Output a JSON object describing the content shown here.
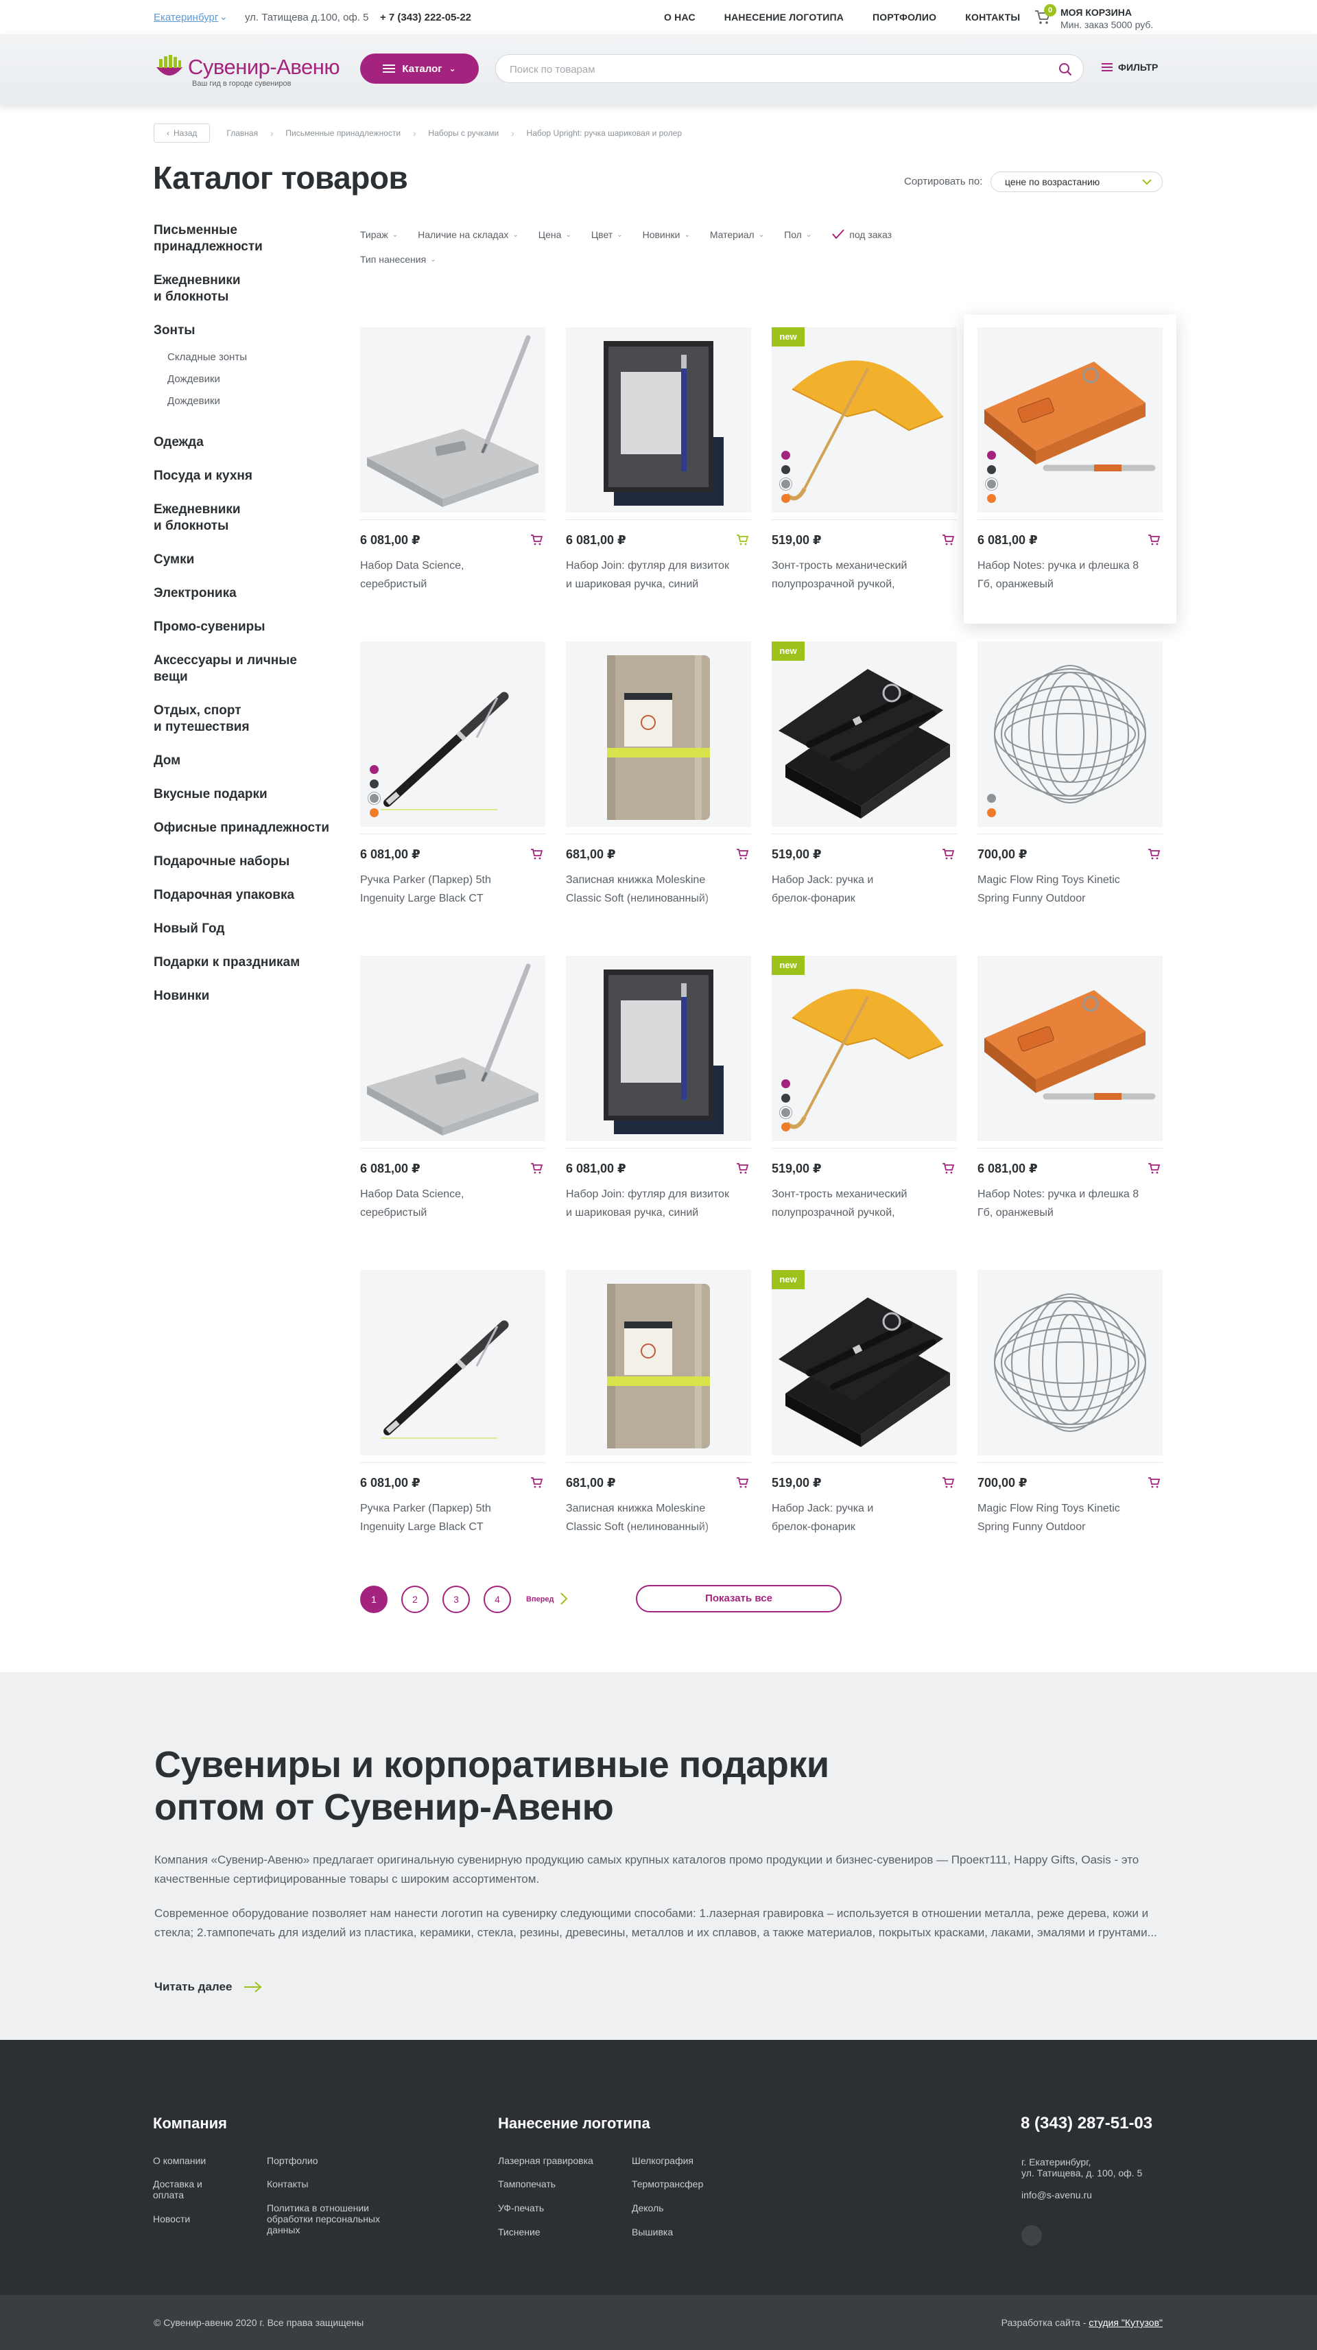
{
  "topbar": {
    "city": "Екатеринбург",
    "address": "ул. Татищева д.100, оф. 5",
    "phone": "+ 7 (343) 222-05-22",
    "nav": [
      "О НАС",
      "НАНЕСЕНИЕ ЛОГОТИПА",
      "ПОРТФОЛИО",
      "КОНТАКТЫ"
    ],
    "cart_count": "0",
    "cart_title": "МОЯ КОРЗИНА",
    "cart_min": "Мин. заказ 5000 руб."
  },
  "header": {
    "logo_name": "Сувенир-Авеню",
    "logo_tagline": "Ваш гид в городе сувениров",
    "catalog_label": "Каталог",
    "search_placeholder": "Поиск по товарам",
    "filter_label": "ФИЛЬТР"
  },
  "breadcrumbs": {
    "back": "Назад",
    "items": [
      "Главная",
      "Письменные принадлежности",
      "Наборы с ручками",
      "Набор Upright: ручка шариковая и ролер"
    ]
  },
  "page": {
    "title": "Каталог товаров",
    "sort_label": "Сортировать по:",
    "sort_value": "цене по возрастанию"
  },
  "sidebar": {
    "items": [
      {
        "label": "Письменные принадлежности",
        "lines": [
          "Письменные",
          "принадлежности"
        ]
      },
      {
        "label": "Ежедневники и блокноты",
        "lines": [
          "Ежедневники",
          "и блокноты"
        ]
      },
      {
        "label": "Зонты",
        "lines": [
          "Зонты"
        ],
        "sub": [
          "Складные зонты",
          "Дождевики",
          "Дождевики"
        ]
      },
      {
        "label": "Одежда",
        "lines": [
          "Одежда"
        ]
      },
      {
        "label": "Посуда и кухня",
        "lines": [
          "Посуда и кухня"
        ]
      },
      {
        "label": "Ежедневники и блокноты",
        "lines": [
          "Ежедневники",
          "и блокноты"
        ]
      },
      {
        "label": "Сумки",
        "lines": [
          "Сумки"
        ]
      },
      {
        "label": "Электроника",
        "lines": [
          "Электроника"
        ]
      },
      {
        "label": "Промо-сувениры",
        "lines": [
          "Промо-сувениры"
        ]
      },
      {
        "label": "Аксессуары и личные вещи",
        "lines": [
          "Аксессуары и личные",
          "вещи"
        ]
      },
      {
        "label": "Отдых, спорт и путешествия",
        "lines": [
          "Отдых, спорт",
          "и путешествия"
        ]
      },
      {
        "label": "Дом",
        "lines": [
          "Дом"
        ]
      },
      {
        "label": "Вкусные подарки",
        "lines": [
          "Вкусные подарки"
        ]
      },
      {
        "label": "Офисные принадлежности",
        "lines": [
          "Офисные принадлежности"
        ]
      },
      {
        "label": "Подарочные наборы",
        "lines": [
          "Подарочные наборы"
        ]
      },
      {
        "label": "Подарочная упаковка",
        "lines": [
          "Подарочная упаковка"
        ]
      },
      {
        "label": "Новый Год",
        "lines": [
          "Новый Год"
        ]
      },
      {
        "label": "Подарки к праздникам",
        "lines": [
          "Подарки к праздникам"
        ]
      },
      {
        "label": "Новинки",
        "lines": [
          "Новинки"
        ]
      }
    ]
  },
  "filters": {
    "row1": [
      "Тираж",
      "Наличие на складах",
      "Цена",
      "Цвет",
      "Новинки",
      "Материал",
      "Пол"
    ],
    "checkbox": "под заказ",
    "row2": [
      "Тип нанесения"
    ]
  },
  "products": [
    {
      "price": "6 081,00 ₽",
      "name": [
        "Набор Data Science,",
        "серебристый"
      ],
      "img": "pen-usb-silver",
      "new": false,
      "swatches": [],
      "cart": "magenta",
      "featured": false
    },
    {
      "price": "6 081,00 ₽",
      "name": [
        "Набор Join: футляр для визиток",
        "и шариковая ручка, синий"
      ],
      "img": "card-case",
      "new": false,
      "swatches": [],
      "cart": "green",
      "featured": false
    },
    {
      "price": "519,00 ₽",
      "name": [
        "Зонт-трость механический",
        "полупрозрачной ручкой,"
      ],
      "img": "umbrella",
      "new": true,
      "new_label": "new",
      "swatches": [
        "#a4237e",
        "#3a3d42",
        "#8e9396",
        "#f07c2a"
      ],
      "cart": "magenta",
      "featured": false
    },
    {
      "price": "6 081,00 ₽",
      "name": [
        "Набор Notes: ручка и флешка 8",
        "Гб, оранжевый"
      ],
      "img": "orange-box",
      "new": false,
      "swatches": [
        "#a4237e",
        "#3a3d42",
        "#8e9396",
        "#f07c2a"
      ],
      "cart": "magenta",
      "featured": true
    },
    {
      "price": "6 081,00 ₽",
      "name": [
        "Ручка Parker (Паркер) 5th",
        "Ingenuity Large Black CT"
      ],
      "img": "parker-pen",
      "new": false,
      "swatches": [
        "#a4237e",
        "#3a3d42",
        "#8e9396",
        "#f07c2a"
      ],
      "cart": "magenta",
      "featured": false
    },
    {
      "price": "681,00 ₽",
      "name": [
        "Записная книжка Moleskine",
        "Classic Soft (нелинованный)"
      ],
      "img": "notebook",
      "new": false,
      "swatches": [],
      "cart": "magenta",
      "featured": false
    },
    {
      "price": "519,00 ₽",
      "name": [
        "Набор Jack: ручка и",
        "брелок-фонарик"
      ],
      "img": "jack-set",
      "new": true,
      "new_label": "new",
      "swatches": [],
      "cart": "magenta",
      "featured": false
    },
    {
      "price": "700,00 ₽",
      "name": [
        "Magic Flow Ring Toys Kinetic",
        "Spring Funny Outdoor"
      ],
      "img": "flow-ring",
      "new": false,
      "swatches": [
        "#8e9396",
        "#f07c2a"
      ],
      "cart": "magenta",
      "featured": false
    },
    {
      "price": "6 081,00 ₽",
      "name": [
        "Набор Data Science,",
        "серебристый"
      ],
      "img": "pen-usb-silver",
      "new": false,
      "swatches": [],
      "cart": "magenta",
      "featured": false
    },
    {
      "price": "6 081,00 ₽",
      "name": [
        "Набор Join: футляр для визиток",
        "и шариковая ручка, синий"
      ],
      "img": "card-case",
      "new": false,
      "swatches": [],
      "cart": "magenta",
      "featured": false
    },
    {
      "price": "519,00 ₽",
      "name": [
        "Зонт-трость механический",
        "полупрозрачной ручкой,"
      ],
      "img": "umbrella",
      "new": true,
      "new_label": "new",
      "swatches": [
        "#a4237e",
        "#3a3d42",
        "#8e9396",
        "#f07c2a"
      ],
      "cart": "magenta",
      "featured": false
    },
    {
      "price": "6 081,00 ₽",
      "name": [
        "Набор Notes: ручка и флешка 8",
        "Гб, оранжевый"
      ],
      "img": "orange-box",
      "new": false,
      "swatches": [],
      "cart": "magenta",
      "featured": false
    },
    {
      "price": "6 081,00 ₽",
      "name": [
        "Ручка Parker (Паркер) 5th",
        "Ingenuity Large Black CT"
      ],
      "img": "parker-pen",
      "new": false,
      "swatches": [],
      "cart": "magenta",
      "featured": false
    },
    {
      "price": "681,00 ₽",
      "name": [
        "Записная книжка Moleskine",
        "Classic Soft (нелинованный)"
      ],
      "img": "notebook",
      "new": false,
      "swatches": [],
      "cart": "magenta",
      "featured": false
    },
    {
      "price": "519,00 ₽",
      "name": [
        "Набор Jack: ручка и",
        "брелок-фонарик"
      ],
      "img": "jack-set",
      "new": true,
      "new_label": "new",
      "swatches": [],
      "cart": "magenta",
      "featured": false
    },
    {
      "price": "700,00 ₽",
      "name": [
        "Magic Flow Ring Toys Kinetic",
        "Spring Funny Outdoor"
      ],
      "img": "flow-ring",
      "new": false,
      "swatches": [],
      "cart": "magenta",
      "featured": false
    }
  ],
  "pagination": {
    "pages": [
      "1",
      "2",
      "3",
      "4"
    ],
    "active": "1",
    "next": "Вперед",
    "show_all": "Показать все"
  },
  "seo": {
    "title_lines": [
      "Сувениры и корпоративные подарки",
      "оптом от Сувенир-Авеню"
    ],
    "p1": "Компания «Сувенир-Авеню» предлагает оригинальную сувенирную продукцию самых крупных каталогов промо продукции и бизнес-сувениров — Проект111, Happy Gifts, Oasis - это качественные сертифицированные товары с широким ассортиментом.",
    "p2": "Современное оборудование позволяет нам нанести логотип на сувенирку следующими способами: 1.лазерная гравировка – используется в отношении металла, реже дерева, кожи и стекла; 2.тампопечать для изделий из пластика, керамики, стекла, резины, древесины, металлов и их сплавов, а также материалов, покрытых красками, лаками, эмалями и грунтами...",
    "read_more": "Читать далее"
  },
  "footer": {
    "company_title": "Компания",
    "company_links_a": [
      "О компании",
      "Доставка и оплата",
      "Новости"
    ],
    "company_links_b": [
      "Портфолио",
      "Контакты",
      "Политика в отношении обработки персональных данных"
    ],
    "logo_title": "Нанесение логотипа",
    "logo_links_a": [
      "Лазерная гравировка",
      "Тампопечать",
      "УФ-печать",
      "Тиснение"
    ],
    "logo_links_b": [
      "Шелкография",
      "Термотрансфер",
      "Деколь",
      "Вышивка"
    ],
    "phone": "8 (343) 287-51-03",
    "address": [
      "г. Екатеринбург,",
      "ул. Татищева, д. 100, оф. 5"
    ],
    "email": "info@s-avenu.ru",
    "copyright": "© Сувенир-авеню 2020 г.  Все права защищены",
    "dev_label": "Разработка сайта - ",
    "dev_link": "студия \"Кутузов\""
  },
  "colors": {
    "brand": "#a4237e",
    "accent": "#9dc21b",
    "text": "#2b3034",
    "footer": "#2c2f33"
  }
}
